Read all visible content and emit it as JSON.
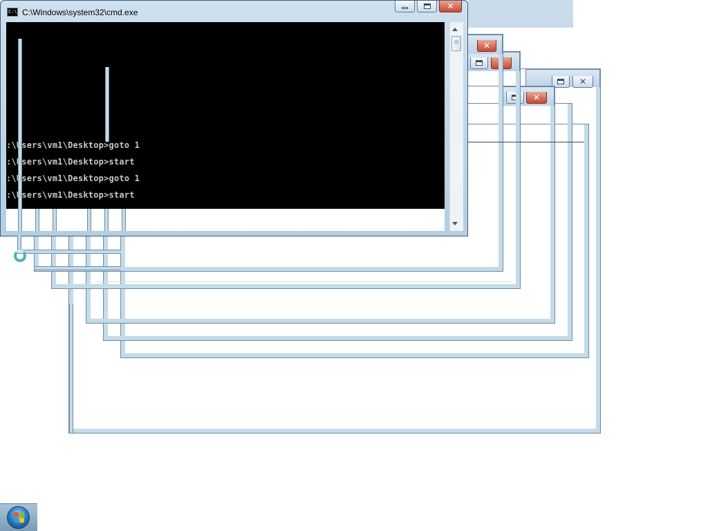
{
  "cmd_window": {
    "title": "C:\\Windows\\system32\\cmd.exe",
    "icon": "console-icon",
    "icon_text": "C:\\",
    "console_lines": [
      ":\\Users\\vm1\\Desktop>goto 1",
      ":\\Users\\vm1\\Desktop>start",
      ":\\Users\\vm1\\Desktop>goto 1",
      ":\\Users\\vm1\\Desktop>start"
    ],
    "colors": {
      "console_bg": "#000000",
      "console_text": "#c8c8c8",
      "frame": "#c4dbe9"
    }
  },
  "ghost_windows": {
    "close_glyph": "✕"
  },
  "taskbar": {
    "start_button": "windows-start-orb-icon"
  },
  "cursor": "busy-spinner-icon"
}
